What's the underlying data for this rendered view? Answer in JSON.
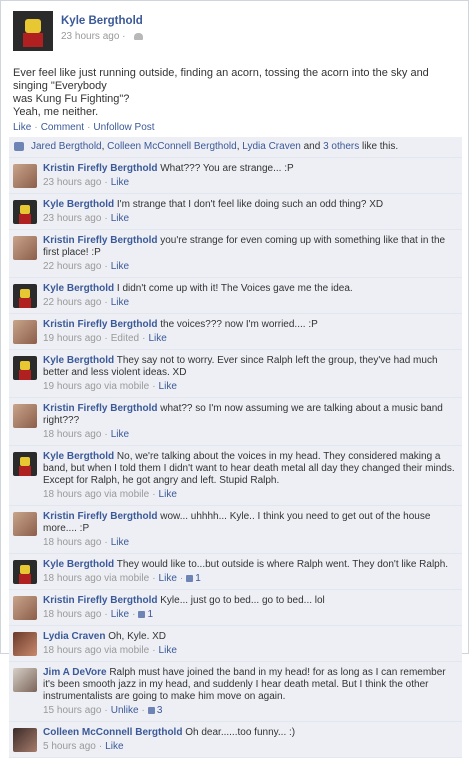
{
  "post": {
    "author": "Kyle Bergthold",
    "time": "23 hours ago",
    "lines": [
      "Ever feel like just running outside, finding an acorn, tossing the acorn into the sky and singing \"Everybody",
      "was Kung Fu Fighting\"?",
      "Yeah, me neither."
    ],
    "actions": [
      "Like",
      "Comment",
      "Unfollow Post"
    ]
  },
  "likes": {
    "names": [
      "Jared Bergthold",
      "Colleen McConnell Bergthold",
      "Lydia Craven"
    ],
    "and_text": "and",
    "others": "3 others",
    "suffix": "like this."
  },
  "comments": [
    {
      "name": "Kristin Firefly Bergthold",
      "avatar": "kf",
      "text": "What??? You are strange... :P",
      "meta": [
        "23 hours ago",
        "Like"
      ]
    },
    {
      "name": "Kyle Bergthold",
      "avatar": "kb",
      "text": "I'm strange that I don't feel like doing such an odd thing? XD",
      "meta": [
        "23 hours ago",
        "Like"
      ]
    },
    {
      "name": "Kristin Firefly Bergthold",
      "avatar": "kf",
      "text": "you're strange for even coming up with something like that in the first place! :P",
      "meta": [
        "22 hours ago",
        "Like"
      ]
    },
    {
      "name": "Kyle Bergthold",
      "avatar": "kb",
      "text": "I didn't come up with it! The Voices gave me the idea.",
      "meta": [
        "22 hours ago",
        "Like"
      ]
    },
    {
      "name": "Kristin Firefly Bergthold",
      "avatar": "kf",
      "text": "the voices??? now I'm worried.... :P",
      "meta": [
        "19 hours ago",
        "Edited",
        "Like"
      ]
    },
    {
      "name": "Kyle Bergthold",
      "avatar": "kb",
      "text": "They say not to worry. Ever since Ralph left the group, they've had much better and less violent ideas. XD",
      "meta": [
        "19 hours ago via mobile",
        "Like"
      ]
    },
    {
      "name": "Kristin Firefly Bergthold",
      "avatar": "kf",
      "text": "what?? so I'm now assuming we are talking about a music band right???",
      "meta": [
        "18 hours ago",
        "Like"
      ]
    },
    {
      "name": "Kyle Bergthold",
      "avatar": "kb",
      "text": "No, we're talking about the voices in my head. They considered making a band, but when I told them I didn't want to hear death metal all day they changed their minds.",
      "extra": "Except for Ralph, he got angry and left. Stupid Ralph.",
      "meta": [
        "18 hours ago via mobile",
        "Like"
      ]
    },
    {
      "name": "Kristin Firefly Bergthold",
      "avatar": "kf",
      "text": "wow... uhhhh... Kyle.. I think you need to get out of the house more.... :P",
      "meta": [
        "18 hours ago",
        "Like"
      ]
    },
    {
      "name": "Kyle Bergthold",
      "avatar": "kb",
      "text": "They would like to...but outside is where Ralph went. They don't like Ralph.",
      "meta": [
        "18 hours ago via mobile",
        "Like"
      ],
      "likecount": "1"
    },
    {
      "name": "Kristin Firefly Bergthold",
      "avatar": "kf",
      "text": "Kyle... just go to bed... go to bed... lol",
      "meta": [
        "18 hours ago",
        "Like"
      ],
      "likecount": "1"
    },
    {
      "name": "Lydia Craven",
      "avatar": "lc",
      "text": "Oh, Kyle. XD",
      "meta": [
        "18 hours ago via mobile",
        "Like"
      ]
    },
    {
      "name": "Jim A DeVore",
      "avatar": "jd",
      "text": "Ralph must have joined the band in my head! for as long as I can remember it's been smooth jazz in my head, and suddenly I hear death metal. But I think the other instrumentalists are going to make him move on again.",
      "meta": [
        "15 hours ago",
        "Unlike"
      ],
      "likecount": "3"
    },
    {
      "name": "Colleen McConnell Bergthold",
      "avatar": "cm",
      "text": "Oh dear......too funny... :)",
      "meta": [
        "5 hours ago",
        "Like"
      ]
    }
  ]
}
